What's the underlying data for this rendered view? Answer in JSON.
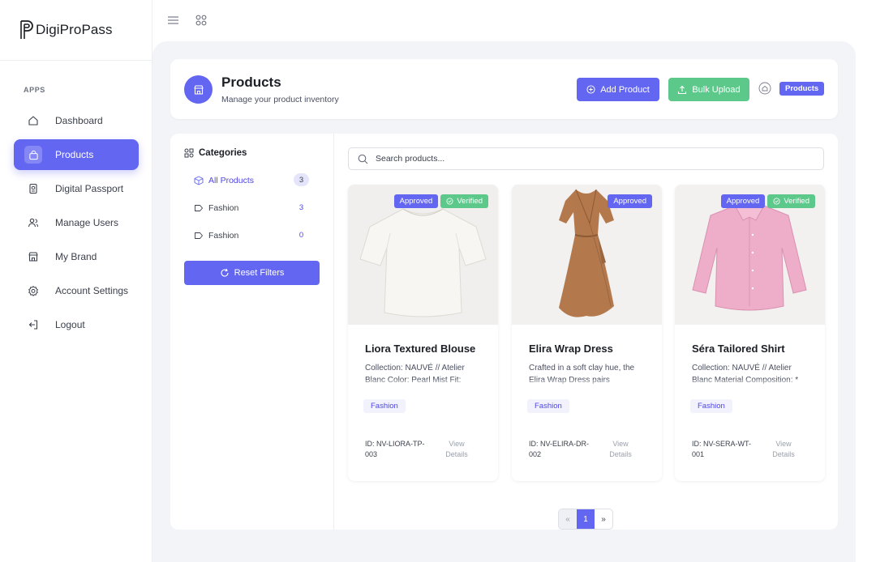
{
  "app": {
    "name": "DigiProPass"
  },
  "sidebar": {
    "section_label": "APPS",
    "items": [
      {
        "label": "Dashboard",
        "icon": "home-icon"
      },
      {
        "label": "Products",
        "icon": "bag-icon",
        "active": true
      },
      {
        "label": "Digital Passport",
        "icon": "passport-icon"
      },
      {
        "label": "Manage Users",
        "icon": "users-icon"
      },
      {
        "label": "My Brand",
        "icon": "store-icon"
      },
      {
        "label": "Account Settings",
        "icon": "gear-icon"
      },
      {
        "label": "Logout",
        "icon": "logout-icon"
      }
    ]
  },
  "header": {
    "title": "Products",
    "subtitle": "Manage your product inventory",
    "add_label": "Add Product",
    "bulk_label": "Bulk Upload",
    "breadcrumb": "Products"
  },
  "categories": {
    "title": "Categories",
    "items": [
      {
        "label": "All Products",
        "count": "3",
        "active": true
      },
      {
        "label": "Fashion",
        "count": "3"
      },
      {
        "label": "Fashion",
        "count": "0"
      }
    ],
    "reset_label": "Reset Filters"
  },
  "search": {
    "placeholder": "Search products...",
    "value": ""
  },
  "products": [
    {
      "name": "Liora Textured Blouse",
      "description": "Collection: NAUVÉ // Atelier Blanc Color: Pearl Mist Fit:",
      "category": "Fashion",
      "id_line1": "ID: NV-LIORA-TP-",
      "id_line2": "003",
      "view_line1": "View",
      "view_line2": "Details",
      "badge_approved": "Approved",
      "badge_verified": "Verified"
    },
    {
      "name": "Elira Wrap Dress",
      "description": "Crafted in a soft clay hue, the Elira Wrap Dress pairs",
      "category": "Fashion",
      "id_line1": "ID: NV-ELIRA-DR-",
      "id_line2": "002",
      "view_line1": "View",
      "view_line2": "Details",
      "badge_approved": "Approved"
    },
    {
      "name": "Séra Tailored Shirt",
      "description": "Collection: NAUVÉ // Atelier Blanc Material Composition: *",
      "category": "Fashion",
      "id_line1": "ID: NV-SERA-WT-",
      "id_line2": "001",
      "view_line1": "View",
      "view_line2": "Details",
      "badge_approved": "Approved",
      "badge_verified": "Verified"
    }
  ],
  "pagination": {
    "prev": "«",
    "current": "1",
    "next": "»"
  },
  "colors": {
    "accent": "#6366f1",
    "success": "#5cc98a",
    "background": "#f3f4f8"
  }
}
